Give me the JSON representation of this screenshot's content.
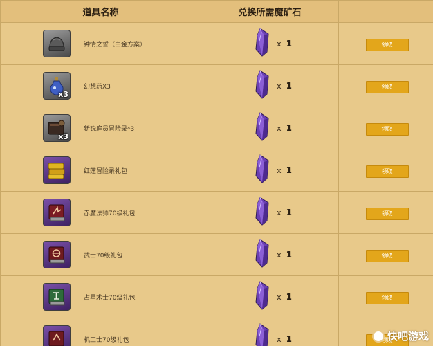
{
  "headers": [
    "道具名称",
    "兑换所需魔矿石",
    ""
  ],
  "button_label": "领取",
  "colors": {
    "background": "#e8c98a",
    "header": "#e3bf7c",
    "button": "#e3a61b",
    "crystal": "#6a3fb3"
  },
  "rows": [
    {
      "name": "钟情之誓（白金方案）",
      "icon": "ring-case-icon",
      "frame": "gray",
      "qty_badge": "",
      "cost_x": "x",
      "cost": "1"
    },
    {
      "name": "幻想药X3",
      "icon": "potion-bottle-icon",
      "frame": "gray",
      "qty_badge": "x3",
      "cost_x": "x",
      "cost": "1"
    },
    {
      "name": "新锐雇员冒险录*3",
      "icon": "dark-book-icon",
      "frame": "gray",
      "qty_badge": "x3",
      "cost_x": "x",
      "cost": "1"
    },
    {
      "name": "红莲冒险录礼包",
      "icon": "gold-books-icon",
      "frame": "purple",
      "qty_badge": "",
      "cost_x": "x",
      "cost": "1"
    },
    {
      "name": "赤魔法师70级礼包",
      "icon": "red-mage-book-icon",
      "frame": "purple",
      "qty_badge": "",
      "cost_x": "x",
      "cost": "1"
    },
    {
      "name": "武士70级礼包",
      "icon": "samurai-book-icon",
      "frame": "purple",
      "qty_badge": "",
      "cost_x": "x",
      "cost": "1"
    },
    {
      "name": "占星术士70级礼包",
      "icon": "astrologian-book-icon",
      "frame": "purple",
      "qty_badge": "",
      "cost_x": "x",
      "cost": "1"
    },
    {
      "name": "机工士70级礼包",
      "icon": "machinist-book-icon",
      "frame": "purple",
      "qty_badge": "",
      "cost_x": "x",
      "cost": "1"
    }
  ],
  "watermark": {
    "text": "快吧游戏",
    "logo": "kuai8-logo-icon"
  }
}
